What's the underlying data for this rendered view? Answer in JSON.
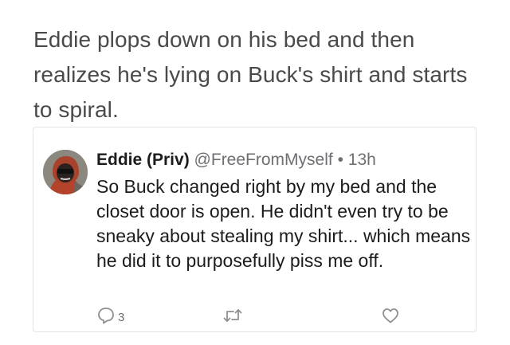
{
  "post": {
    "text": "Eddie plops down on his bed and then realizes he's lying on Buck's shirt and starts to spiral."
  },
  "quoted_tweet": {
    "display_name": "Eddie (Priv)",
    "handle": "@FreeFromMyself",
    "separator": "•",
    "time": "13h",
    "body": "So Buck changed right by my bed and the closet door is open. He didn't even try to be sneaky about stealing my shirt... which means he did it to purposefully piss me off.",
    "actions": {
      "reply": {
        "icon": "reply-icon",
        "count": "3"
      },
      "retweet": {
        "icon": "retweet-icon"
      },
      "like": {
        "icon": "heart-icon"
      }
    }
  },
  "colors": {
    "text_primary": "#1c1c1e",
    "text_secondary": "#6e6e73",
    "icon_gray": "#8e8e93",
    "border": "#e3e3e6"
  }
}
